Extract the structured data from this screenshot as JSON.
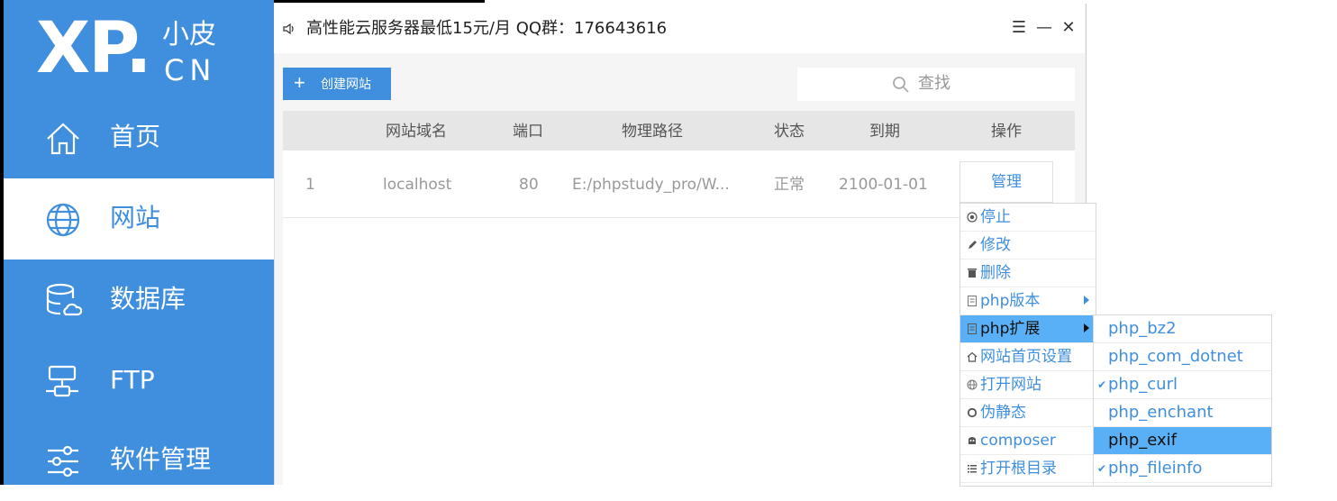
{
  "logo": {
    "xp": "XP.",
    "cn_top": "小皮",
    "cn_bottom": "CN"
  },
  "nav": [
    {
      "label": "首页",
      "icon": "home-icon"
    },
    {
      "label": "网站",
      "icon": "globe-icon"
    },
    {
      "label": "数据库",
      "icon": "database-icon"
    },
    {
      "label": "FTP",
      "icon": "ftp-icon"
    },
    {
      "label": "软件管理",
      "icon": "sliders-icon"
    }
  ],
  "titlebar": {
    "notice": "高性能云服务器最低15元/月  QQ群：176643616",
    "menu_glyph": "☰",
    "minimize_glyph": "—",
    "close_glyph": "✕"
  },
  "toolbar": {
    "create_plus": "+",
    "create_label": "创建网站",
    "search_placeholder": "查找"
  },
  "table": {
    "headers": [
      "网站域名",
      "端口",
      "物理路径",
      "状态",
      "到期",
      "操作"
    ],
    "rows": [
      {
        "index": "1",
        "domain": "localhost",
        "port": "80",
        "path": "E:/phpstudy_pro/W...",
        "status": "正常",
        "expire": "2100-01-01",
        "action": "管理"
      }
    ]
  },
  "context_menu": [
    {
      "label": "停止",
      "icon": "stop-icon"
    },
    {
      "label": "修改",
      "icon": "pencil-icon"
    },
    {
      "label": "删除",
      "icon": "trash-icon"
    },
    {
      "label": "php版本",
      "icon": "document-icon",
      "has_submenu": true
    },
    {
      "label": "php扩展",
      "icon": "document-icon",
      "has_submenu": true,
      "highlighted": true
    },
    {
      "label": "网站首页设置",
      "icon": "home-small-icon"
    },
    {
      "label": "打开网站",
      "icon": "globe-small-icon"
    },
    {
      "label": "伪静态",
      "icon": "refresh-icon"
    },
    {
      "label": "composer",
      "icon": "composer-icon"
    },
    {
      "label": "打开根目录",
      "icon": "list-icon"
    }
  ],
  "submenu": [
    {
      "label": "php_bz2",
      "checked": false
    },
    {
      "label": "php_com_dotnet",
      "checked": false
    },
    {
      "label": "php_curl",
      "checked": true
    },
    {
      "label": "php_enchant",
      "checked": false
    },
    {
      "label": "php_exif",
      "checked": false,
      "highlighted": true
    },
    {
      "label": "php_fileinfo",
      "checked": true
    }
  ],
  "check_glyph": "✔",
  "colors": {
    "brand_blue": "#3f8fde",
    "highlight": "#5ab0f6"
  }
}
